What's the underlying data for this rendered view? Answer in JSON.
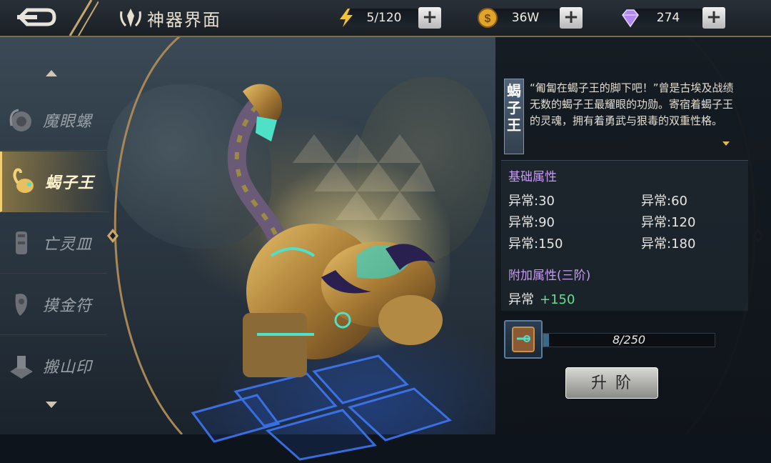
{
  "header": {
    "title": "神器界面",
    "resources": [
      {
        "icon": "lightning-icon",
        "value": "5/120"
      },
      {
        "icon": "gold-coin-icon",
        "value": "36W"
      },
      {
        "icon": "diamond-gem-icon",
        "value": "274"
      }
    ],
    "plus_label": "+"
  },
  "artifact_list": {
    "items": [
      {
        "label": "魔眼螺",
        "icon": "snail-icon",
        "active": false
      },
      {
        "label": "蝎子王",
        "icon": "scorpion-icon",
        "active": true
      },
      {
        "label": "亡灵皿",
        "icon": "chalice-icon",
        "active": false
      },
      {
        "label": "摸金符",
        "icon": "talisman-icon",
        "active": false
      },
      {
        "label": "搬山印",
        "icon": "seal-icon",
        "active": false
      }
    ]
  },
  "detail": {
    "name": "蝎子王",
    "description": "“匍匐在蝎子王的脚下吧！”曾是古埃及战绩无数的蝎子王最耀眼的功勋。寄宿着蝎子王的灵魂，拥有着勇武与狠毒的双重性格。",
    "base_title": "基础属性",
    "base_attrs": [
      "异常:30",
      "异常:60",
      "异常:90",
      "异常:120",
      "异常:150",
      "异常:180"
    ],
    "extra_title": "附加属性(三阶)",
    "extra_label": "异常",
    "extra_value": "+150",
    "material_progress": "8/250",
    "material_fraction": 0.032,
    "upgrade_label": "升阶"
  },
  "colors": {
    "accent_gold": "#f1cf74",
    "attr_title": "#c89cf2",
    "extra_green": "#63e08e"
  }
}
